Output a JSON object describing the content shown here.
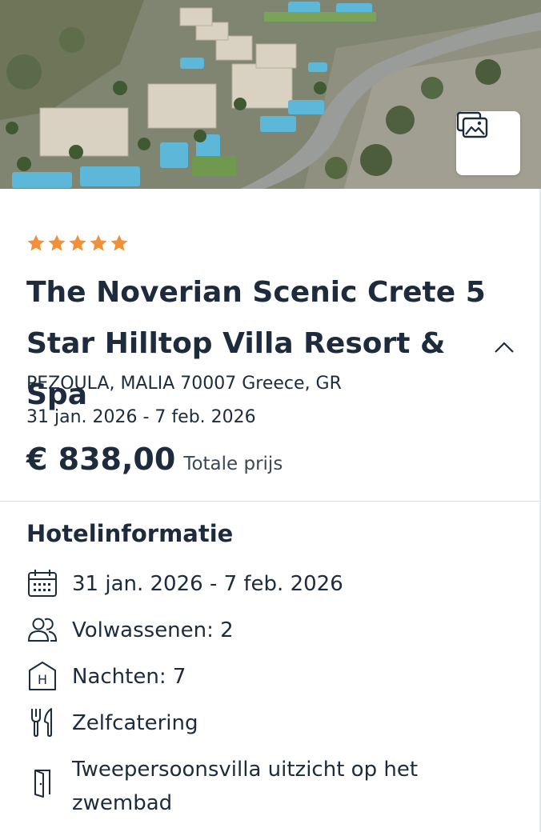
{
  "hero": {
    "gallery_icon": "photo-gallery-icon"
  },
  "hotel": {
    "stars": 5,
    "star_color": "#f0913a",
    "name": "The Noverian Scenic Crete 5 Star Hilltop Villa Resort & Spa",
    "address": "PEZOULA, MALIA 70007 Greece, GR",
    "dates": "31 jan. 2026 - 7 feb. 2026",
    "price": "€ 838,00",
    "price_label": "Totale prijs"
  },
  "info": {
    "title": "Hotelinformatie",
    "items": [
      {
        "icon": "calendar-icon",
        "text": "31 jan. 2026 - 7 feb. 2026"
      },
      {
        "icon": "people-icon",
        "text": "Volwassenen: 2"
      },
      {
        "icon": "hotel-icon",
        "text": "Nachten: 7"
      },
      {
        "icon": "fork-knife-icon",
        "text": "Zelfcatering"
      },
      {
        "icon": "door-icon",
        "text": "Tweepersoonsvilla uitzicht op het zwembad"
      }
    ]
  },
  "colors": {
    "text": "#1d2b3d",
    "divider": "#d8dce2"
  }
}
